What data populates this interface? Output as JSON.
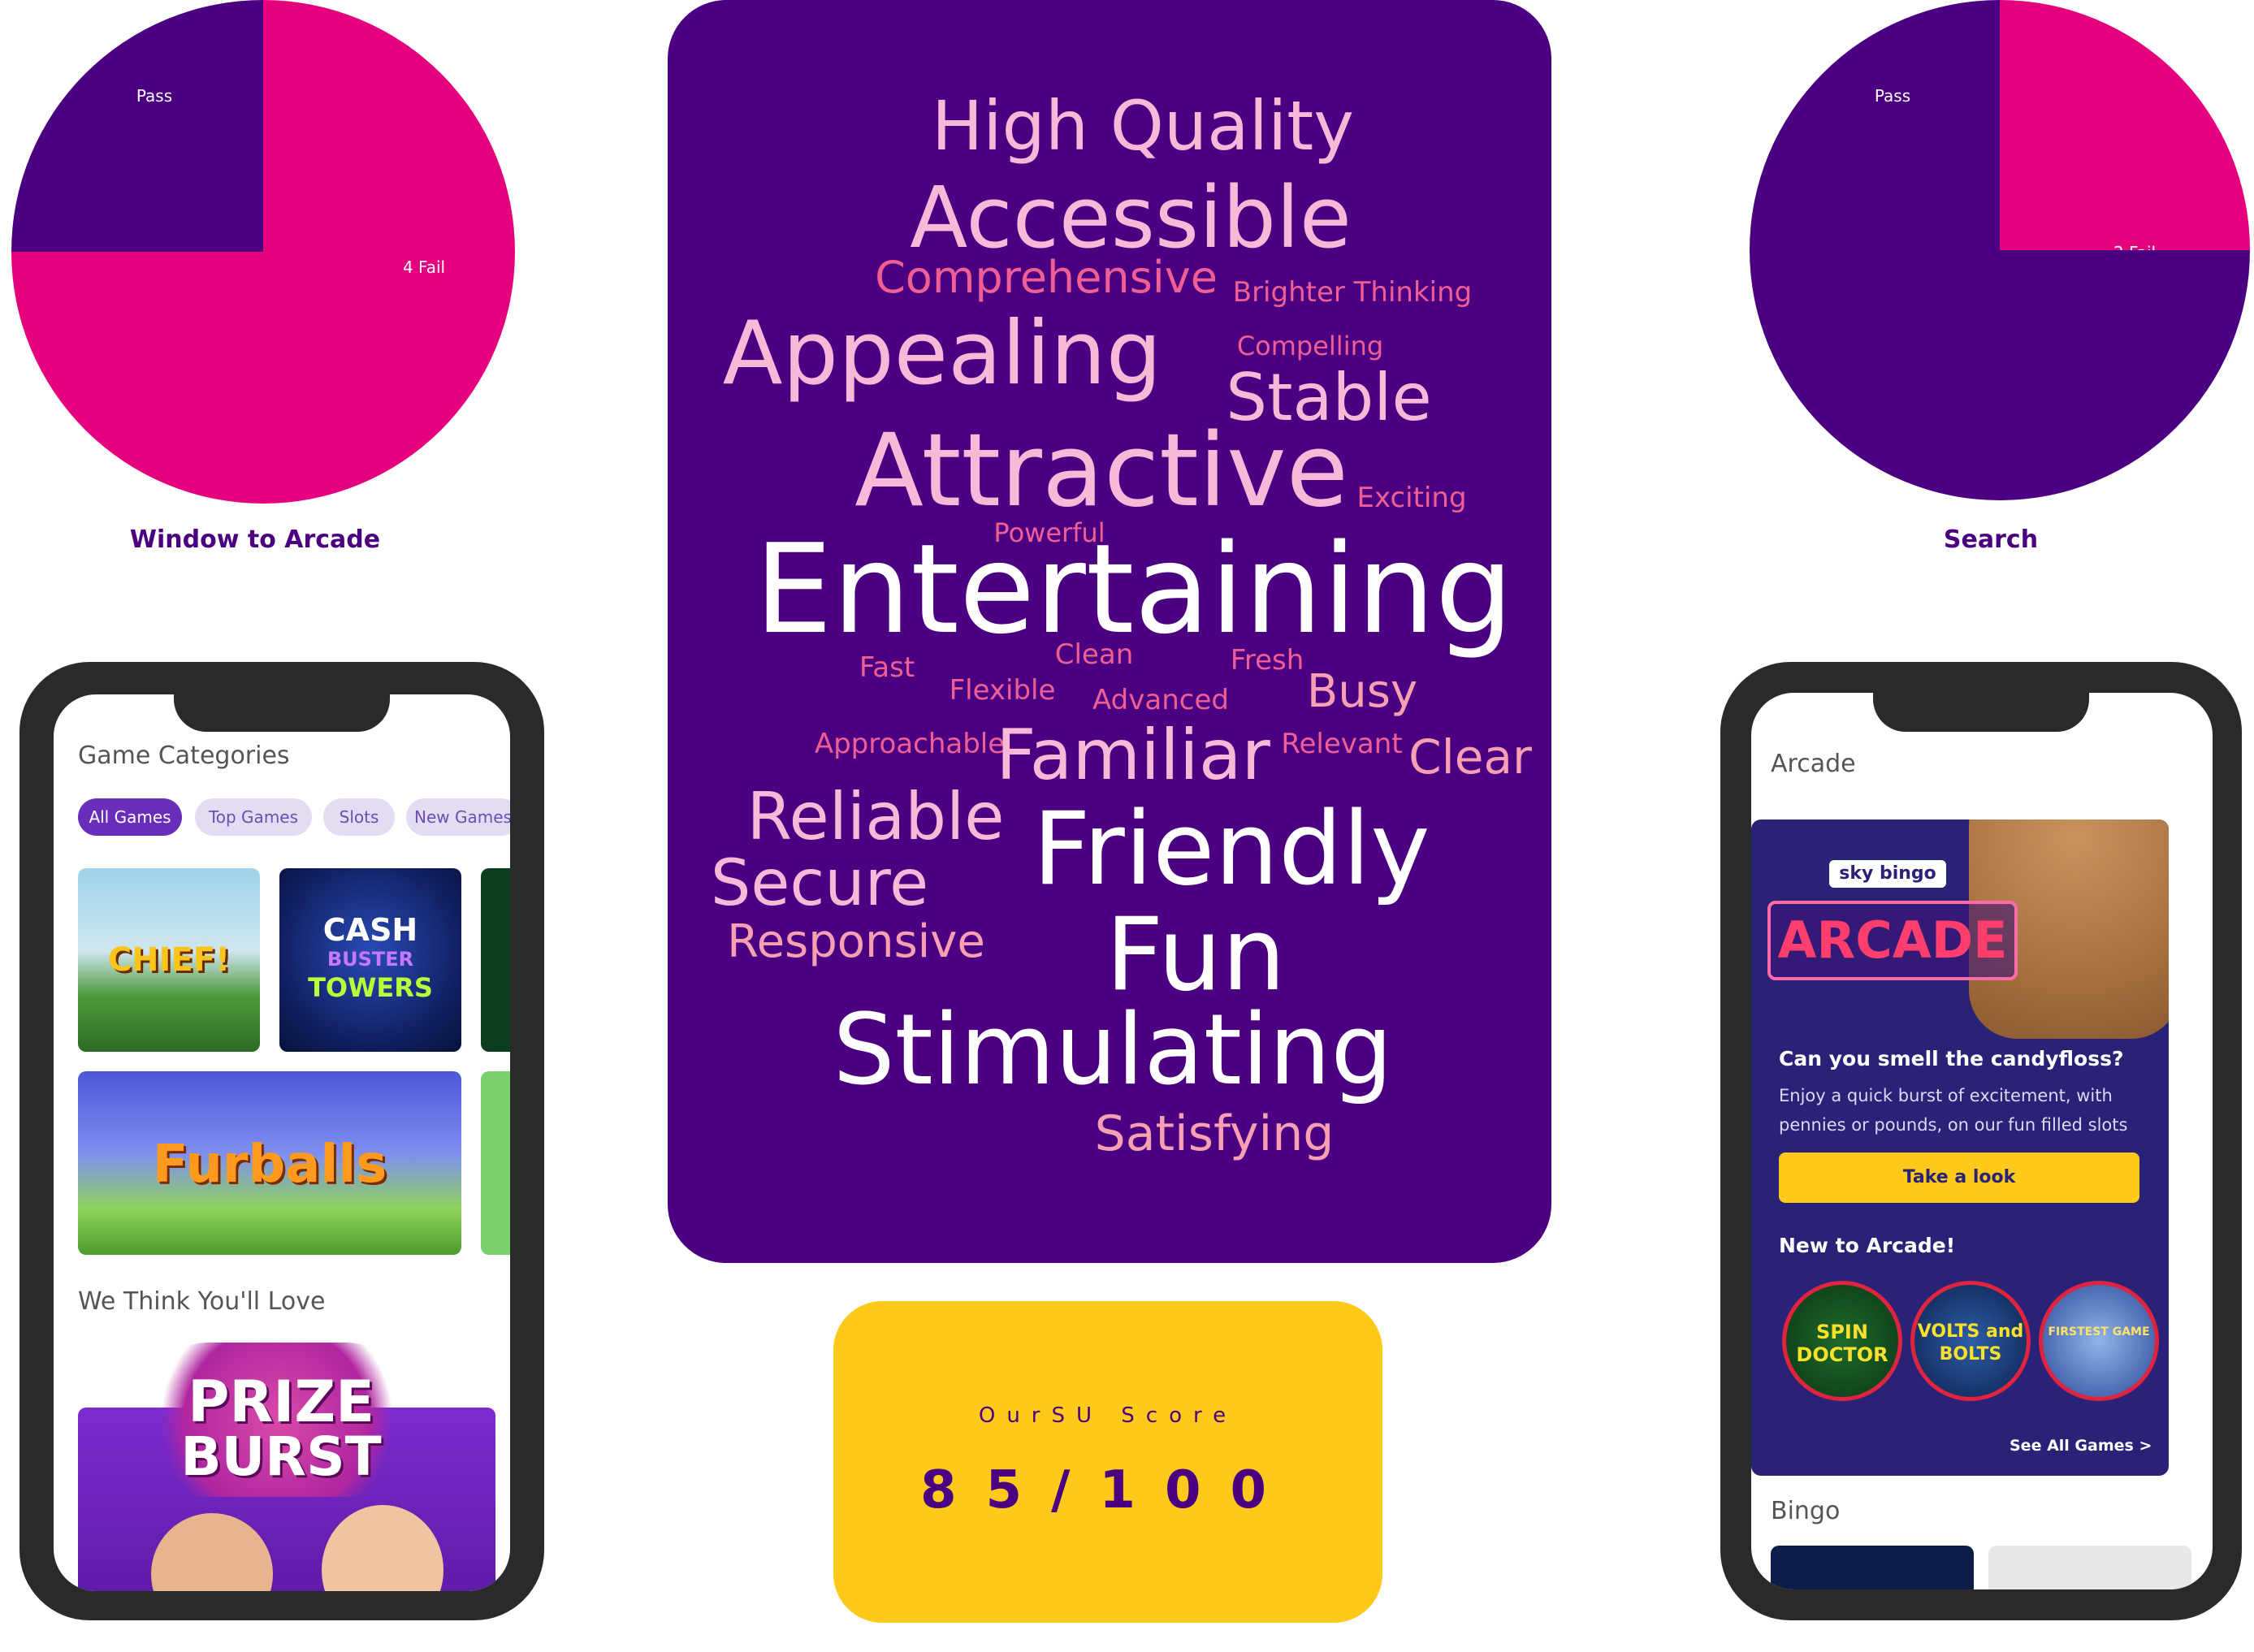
{
  "colors": {
    "purple": "#4b0082",
    "magenta": "#e5007e",
    "yellow": "#fdc91a",
    "cloud_bright": "#ffffff",
    "cloud_light": "#f8b8d8",
    "cloud_mid": "#f7a0b4",
    "cloud_accent": "#ef5f95"
  },
  "chart_data": [
    {
      "type": "pie",
      "title": "Window to Arcade",
      "slices": [
        {
          "label": "Pass",
          "value": 1,
          "color": "#4b0082"
        },
        {
          "label": "4 Fail",
          "value": 3,
          "color": "#e5007e"
        }
      ]
    },
    {
      "type": "pie",
      "title": "Search",
      "slices": [
        {
          "label": "2 Fail",
          "value": 1,
          "color": "#e5007e"
        },
        {
          "label": "Pass",
          "value": 3,
          "color": "#4b0082"
        }
      ]
    }
  ],
  "word_cloud": {
    "words": [
      {
        "text": "High Quality",
        "tone": "cloud_light"
      },
      {
        "text": "Accessible",
        "tone": "cloud_light"
      },
      {
        "text": "Comprehensive",
        "tone": "cloud_accent"
      },
      {
        "text": "Brighter Thinking",
        "tone": "cloud_accent"
      },
      {
        "text": "Appealing",
        "tone": "cloud_light"
      },
      {
        "text": "Compelling",
        "tone": "cloud_accent"
      },
      {
        "text": "Stable",
        "tone": "cloud_light"
      },
      {
        "text": "Attractive",
        "tone": "cloud_light"
      },
      {
        "text": "Exciting",
        "tone": "cloud_accent"
      },
      {
        "text": "Powerful",
        "tone": "cloud_accent"
      },
      {
        "text": "Entertaining",
        "tone": "cloud_bright"
      },
      {
        "text": "Fast",
        "tone": "cloud_accent"
      },
      {
        "text": "Clean",
        "tone": "cloud_accent"
      },
      {
        "text": "Fresh",
        "tone": "cloud_accent"
      },
      {
        "text": "Flexible",
        "tone": "cloud_accent"
      },
      {
        "text": "Advanced",
        "tone": "cloud_accent"
      },
      {
        "text": "Busy",
        "tone": "cloud_mid"
      },
      {
        "text": "Approachable",
        "tone": "cloud_accent"
      },
      {
        "text": "Familiar",
        "tone": "cloud_light"
      },
      {
        "text": "Relevant",
        "tone": "cloud_accent"
      },
      {
        "text": "Clear",
        "tone": "cloud_mid"
      },
      {
        "text": "Reliable",
        "tone": "cloud_light"
      },
      {
        "text": "Friendly",
        "tone": "cloud_bright"
      },
      {
        "text": "Secure",
        "tone": "cloud_light"
      },
      {
        "text": "Responsive",
        "tone": "cloud_mid"
      },
      {
        "text": "Fun",
        "tone": "cloud_bright"
      },
      {
        "text": "Stimulating",
        "tone": "cloud_bright"
      },
      {
        "text": "Satisfying",
        "tone": "cloud_mid"
      }
    ]
  },
  "score": {
    "label": "OurSU Score",
    "value": "85/100"
  },
  "left_phone": {
    "section_title": "Game Categories",
    "chips": [
      "All Games",
      "Top Games",
      "Slots",
      "New Games"
    ],
    "active_chip": "All Games",
    "games": [
      "CHIEF!",
      "CASH",
      "BUSTER",
      "TOWERS",
      "Furballs"
    ],
    "recommend_title": "We Think You'll Love",
    "promo": [
      "PRIZE",
      "BURST"
    ]
  },
  "right_phone": {
    "section_title": "Arcade",
    "brand": "sky bingo",
    "arcade_logo": "ARCADE",
    "headline": "Can you smell the candyfloss?",
    "body": "Enjoy a quick burst of excitement, with pennies or pounds, on our fun filled slots",
    "cta": "Take a look",
    "new_title": "New to Arcade!",
    "round_games": [
      "SPIN DOCTOR",
      "VOLTS and BOLTS",
      "FIRSTEST GAME"
    ],
    "see_all": "See All Games >",
    "bingo_title": "Bingo"
  }
}
